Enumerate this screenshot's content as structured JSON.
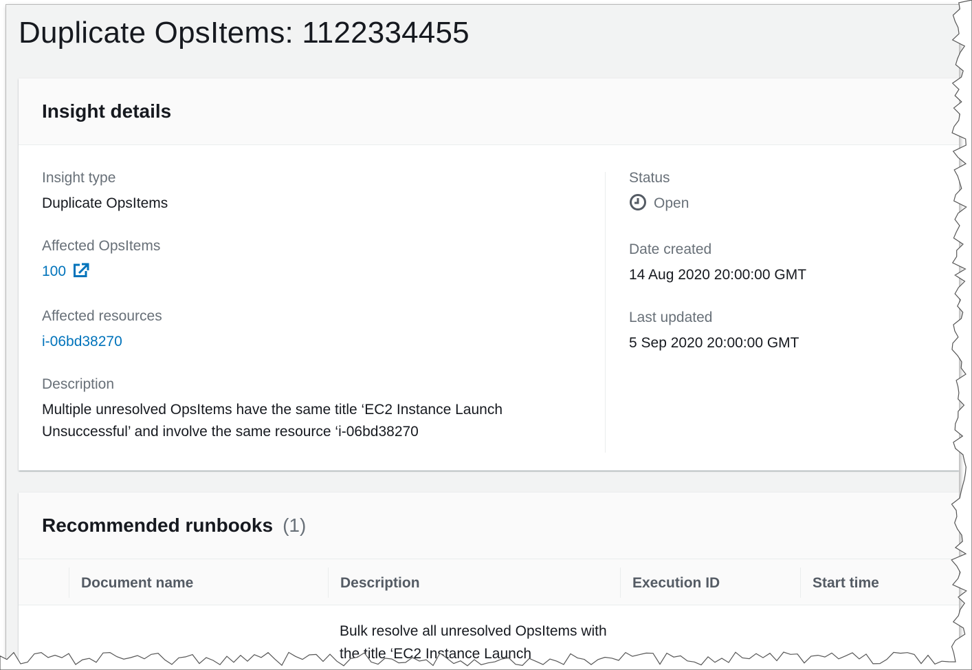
{
  "page": {
    "title": "Duplicate OpsItems: 1122334455"
  },
  "insight_details": {
    "title": "Insight details",
    "fields_left": {
      "insight_type": {
        "label": "Insight type",
        "value": "Duplicate OpsItems"
      },
      "affected_opsitems": {
        "label": "Affected OpsItems",
        "value": "100"
      },
      "affected_resources": {
        "label": "Affected resources",
        "value": "i-06bd38270"
      },
      "description": {
        "label": "Description",
        "value": "Multiple unresolved OpsItems have the same title ‘EC2 Instance Launch Unsuccessful’ and involve the same resource ‘i-06bd38270"
      }
    },
    "fields_right": {
      "status": {
        "label": "Status",
        "value": "Open"
      },
      "date_created": {
        "label": "Date created",
        "value": "14 Aug 2020 20:00:00 GMT"
      },
      "last_updated": {
        "label": "Last updated",
        "value": "5 Sep 2020 20:00:00 GMT"
      }
    }
  },
  "recommended_runbooks": {
    "title": "Recommended runbooks",
    "count": "(1)",
    "columns": {
      "document_name": "Document name",
      "description": "Description",
      "execution_id": "Execution ID",
      "start_time": "Start time"
    },
    "rows": [
      {
        "description": "Bulk resolve all unresolved OpsItems with the title ‘EC2 Instance Launch"
      }
    ]
  },
  "icons": {
    "external_link": "external-link-icon",
    "status_open": "clock-icon"
  },
  "colors": {
    "link": "#0073bb",
    "text": "#16191f",
    "label": "#687078",
    "background": "#f2f3f3"
  }
}
